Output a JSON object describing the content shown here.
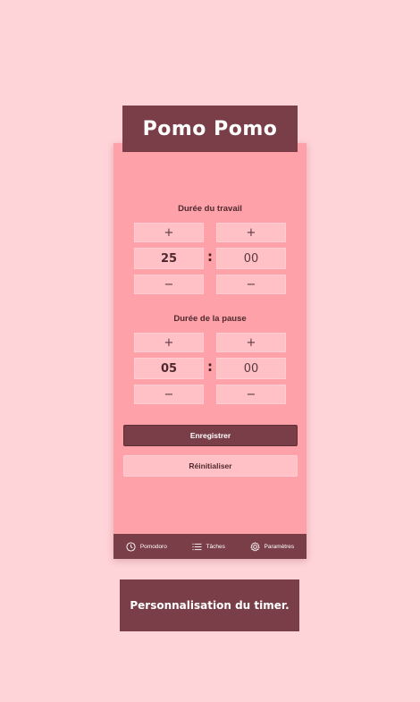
{
  "app": {
    "title": "Pomo Pomo"
  },
  "work": {
    "label": "Durée du travail",
    "plus": "+",
    "minus": "−",
    "minutes": "25",
    "separator": ":",
    "seconds": "00"
  },
  "pause": {
    "label": "Durée de la pause",
    "plus": "+",
    "minus": "−",
    "minutes": "05",
    "separator": ":",
    "seconds": "00"
  },
  "actions": {
    "save": "Enregistrer",
    "reset": "Réinitialiser"
  },
  "nav": {
    "items": [
      {
        "label": "Pomodoro",
        "icon": "clock-icon"
      },
      {
        "label": "Tâches",
        "icon": "list-icon"
      },
      {
        "label": "Paramètres",
        "icon": "gear-icon"
      }
    ]
  },
  "caption": "Personnalisation du timer.",
  "colors": {
    "background": "#ffd4d8",
    "panel": "#ffa1a8",
    "accent": "#7a3e48",
    "box": "#ffc0c6"
  }
}
